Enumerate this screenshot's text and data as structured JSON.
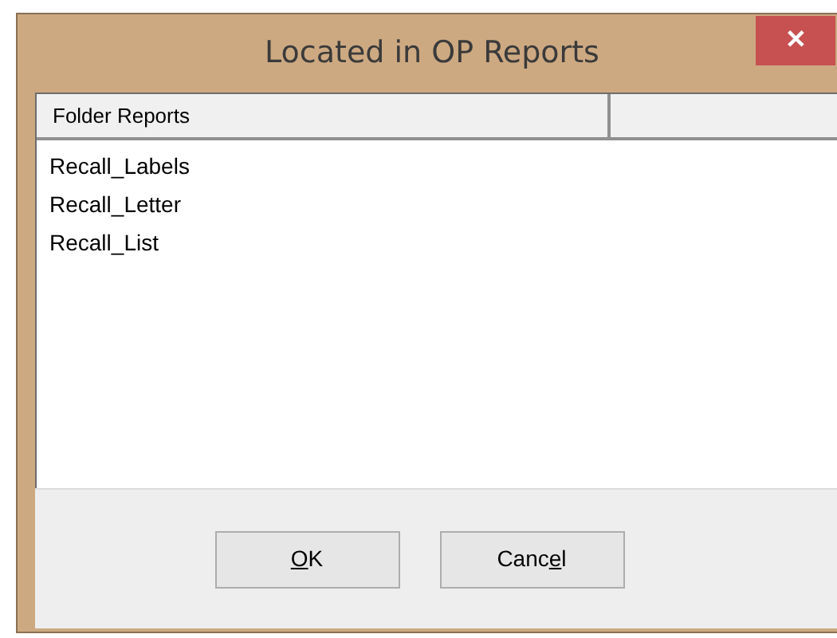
{
  "window": {
    "title": "Located in OP Reports",
    "close": "✕"
  },
  "list": {
    "columns": [
      "Folder Reports"
    ],
    "items": [
      "Recall_Labels",
      "Recall_Letter",
      "Recall_List"
    ]
  },
  "buttons": [
    {
      "key": "O",
      "after": "K"
    },
    {
      "before": "Canc",
      "key": "e",
      "after": "l"
    }
  ]
}
